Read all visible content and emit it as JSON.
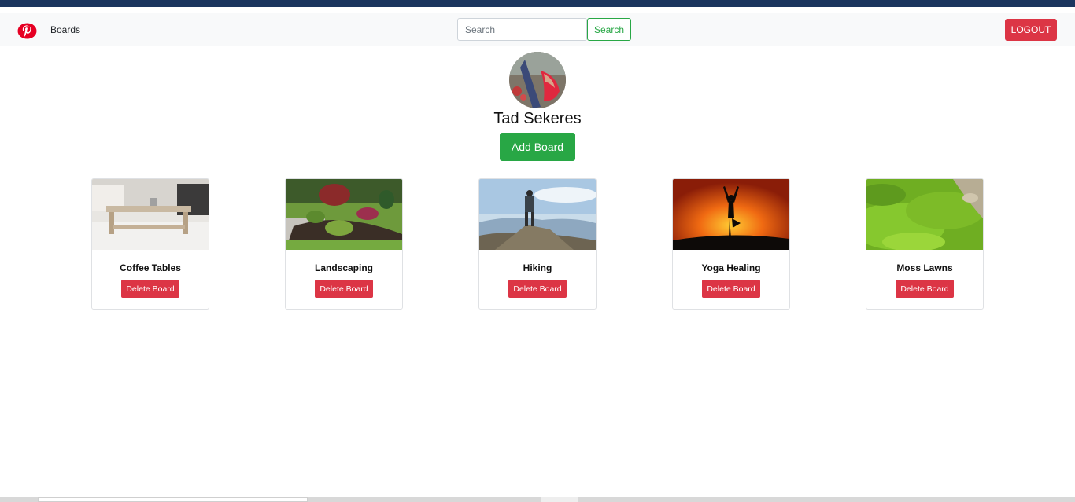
{
  "nav": {
    "brand_icon": "pinterest-logo-icon",
    "brand_color": "#e60023",
    "boards_link": "Boards",
    "search_placeholder": "Search",
    "search_button": "Search",
    "logout_button": "LOGOUT"
  },
  "profile": {
    "name": "Tad Sekeres",
    "add_board_button": "Add Board"
  },
  "boards": [
    {
      "title": "Coffee Tables",
      "delete_label": "Delete Board"
    },
    {
      "title": "Landscaping",
      "delete_label": "Delete Board"
    },
    {
      "title": "Hiking",
      "delete_label": "Delete Board"
    },
    {
      "title": "Yoga Healing",
      "delete_label": "Delete Board"
    },
    {
      "title": "Moss Lawns",
      "delete_label": "Delete Board"
    }
  ],
  "colors": {
    "topbar": "#1b355e",
    "success": "#28a745",
    "danger": "#dc3545"
  }
}
